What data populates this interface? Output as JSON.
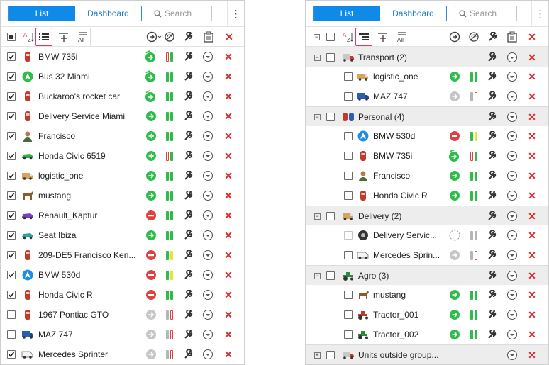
{
  "tabs": {
    "list": "List",
    "dashboard": "Dashboard"
  },
  "search": {
    "placeholder": "Search"
  },
  "colors": {
    "accent": "#0f8ae9",
    "green": "#2ebd4b",
    "red": "#e04040",
    "gray": "#b5b5b5",
    "yellow": "#e8e23a",
    "delete": "#e02525"
  },
  "left_units": [
    {
      "name": "BMW 735i",
      "checked": true,
      "icon": "car-red-icon",
      "status": "moving-green-icon",
      "bars": [
        "red",
        "green"
      ]
    },
    {
      "name": "Bus 32 Miami",
      "checked": true,
      "icon": "bus-green-circle-icon",
      "status": "moving-green-icon",
      "bars": [
        "green",
        "green"
      ]
    },
    {
      "name": "Buckaroo's rocket car",
      "checked": true,
      "icon": "car-red-icon",
      "status": "moving-green-icon",
      "bars": [
        "green",
        "green"
      ]
    },
    {
      "name": "Delivery Service Miami",
      "checked": true,
      "icon": "car-red-icon",
      "status": "arrow-green-icon",
      "bars": [
        "green",
        "green"
      ]
    },
    {
      "name": "Francisco",
      "checked": true,
      "icon": "person-icon",
      "status": "arrow-green-icon",
      "bars": [
        "green",
        "green"
      ]
    },
    {
      "name": "Honda Civic 6519",
      "checked": true,
      "icon": "car-green-icon",
      "status": "arrow-green-icon",
      "bars": [
        "red",
        "green"
      ]
    },
    {
      "name": "logistic_one",
      "checked": true,
      "icon": "van-icon",
      "status": "arrow-green-icon",
      "bars": [
        "green",
        "green"
      ]
    },
    {
      "name": "mustang",
      "checked": true,
      "icon": "horse-icon",
      "status": "arrow-green-icon",
      "bars": [
        "green",
        "green"
      ]
    },
    {
      "name": "Renault_Kaptur",
      "checked": true,
      "icon": "car-purple-icon",
      "status": "stop-red-icon",
      "bars": [
        "green",
        "green"
      ]
    },
    {
      "name": "Seat Ibiza",
      "checked": true,
      "icon": "car-teal-icon",
      "status": "arrow-green-icon",
      "bars": [
        "green",
        "green"
      ]
    },
    {
      "name": "209-DE5 Francisco Ken...",
      "checked": true,
      "icon": "car-red-icon",
      "status": "stop-red-icon",
      "bars": [
        "green",
        "yellow"
      ]
    },
    {
      "name": "BMW 530d",
      "checked": true,
      "icon": "arrow-blue-circle-icon",
      "status": "stop-red-icon",
      "bars": [
        "green",
        "yellow"
      ]
    },
    {
      "name": "Honda Civic R",
      "checked": true,
      "icon": "car-red-icon",
      "status": "stop-red-icon",
      "bars": [
        "green",
        "green"
      ]
    },
    {
      "name": "1967 Pontiac GTO",
      "checked": false,
      "icon": "car-red-icon",
      "status": "arrow-gray-icon",
      "bars": [
        "gray",
        "red"
      ]
    },
    {
      "name": "MAZ 747",
      "checked": false,
      "icon": "truck-blue-icon",
      "status": "arrow-gray-icon",
      "bars": [
        "gray",
        "red"
      ]
    },
    {
      "name": "Mercedes Sprinter",
      "checked": true,
      "icon": "van-white-icon",
      "status": "arrow-gray-icon",
      "bars": [
        "gray",
        "red"
      ]
    }
  ],
  "right_rows": [
    {
      "type": "group",
      "name": "Transport (2)",
      "icon": "truck-red-icon",
      "expanded": true
    },
    {
      "type": "unit",
      "name": "logistic_one",
      "icon": "van-icon",
      "status": "arrow-green-icon",
      "bars": [
        "green",
        "green"
      ]
    },
    {
      "type": "unit",
      "name": "MAZ 747",
      "icon": "truck-blue-icon",
      "status": "arrow-gray-icon",
      "bars": [
        "gray",
        "red"
      ]
    },
    {
      "type": "group",
      "name": "Personal (4)",
      "icon": "cars-group-icon",
      "expanded": true
    },
    {
      "type": "unit",
      "name": "BMW 530d",
      "icon": "arrow-blue-circle-icon",
      "status": "stop-red-icon",
      "bars": [
        "green",
        "yellow"
      ]
    },
    {
      "type": "unit",
      "name": "BMW 735i",
      "icon": "car-red-icon",
      "status": "moving-green-icon",
      "bars": [
        "red",
        "green"
      ]
    },
    {
      "type": "unit",
      "name": "Francisco",
      "icon": "person-icon",
      "status": "arrow-green-icon",
      "bars": [
        "green",
        "green"
      ]
    },
    {
      "type": "unit",
      "name": "Honda Civic R",
      "icon": "car-red-icon",
      "status": "arrow-green-icon",
      "bars": [
        "green",
        "green"
      ]
    },
    {
      "type": "group",
      "name": "Delivery (2)",
      "icon": "van-icon",
      "expanded": true
    },
    {
      "type": "unit",
      "name": "Delivery Servic...",
      "icon": "tire-icon",
      "status": "dashed-circle-icon",
      "bars": [
        "gray",
        "gray"
      ],
      "dim": true
    },
    {
      "type": "unit",
      "name": "Mercedes Sprin...",
      "icon": "van-white-icon",
      "status": "arrow-gray-icon",
      "bars": [
        "gray",
        "red"
      ]
    },
    {
      "type": "group",
      "name": "Agro (3)",
      "icon": "tractor-green-icon",
      "expanded": true
    },
    {
      "type": "unit",
      "name": "mustang",
      "icon": "horse-icon",
      "status": "arrow-green-icon",
      "bars": [
        "green",
        "green"
      ]
    },
    {
      "type": "unit",
      "name": "Tractor_001",
      "icon": "tractor-red-icon",
      "status": "arrow-green-icon",
      "bars": [
        "green",
        "green"
      ]
    },
    {
      "type": "unit",
      "name": "Tractor_002",
      "icon": "tractor-green-icon",
      "status": "arrow-green-icon",
      "bars": [
        "green",
        "green"
      ]
    },
    {
      "type": "group",
      "name": "Units outside group...",
      "icon": "truck-red-icon",
      "expanded": false,
      "noWrench": true
    }
  ]
}
